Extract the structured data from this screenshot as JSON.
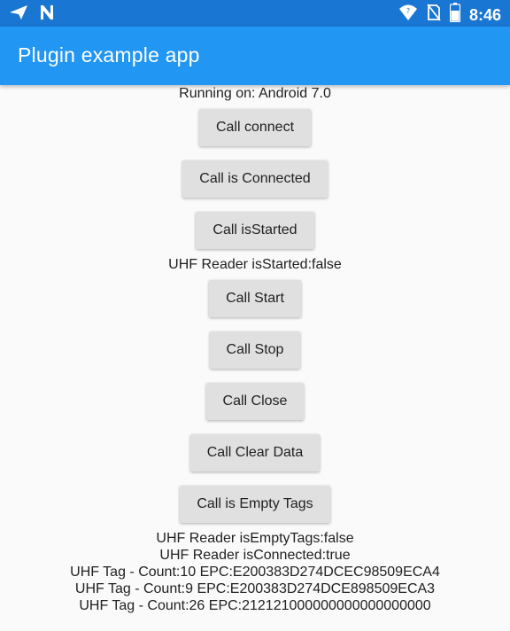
{
  "status_bar": {
    "time": "8:46",
    "icons_left": [
      "navigation-arrow-icon",
      "n-logo-icon"
    ],
    "icons_right": [
      "wifi-icon",
      "no-sim-icon",
      "battery-icon"
    ]
  },
  "app_bar": {
    "title": "Plugin example app",
    "color": "#2196f3"
  },
  "main": {
    "running_on": "Running on: Android 7.0",
    "buttons": {
      "connect": "Call connect",
      "is_connected": "Call is Connected",
      "is_started": "Call isStarted",
      "start": "Call Start",
      "stop": "Call Stop",
      "close": "Call Close",
      "clear_data": "Call Clear Data",
      "is_empty_tags": "Call is Empty Tags"
    },
    "is_started_status": "UHF Reader isStarted:false",
    "results": [
      "UHF Reader isEmptyTags:false",
      "UHF Reader isConnected:true",
      "UHF Tag - Count:10 EPC:E200383D274DCEC98509ECA4",
      "UHF Tag - Count:9 EPC:E200383D274DCE898509ECA3",
      "UHF Tag - Count:26 EPC:212121000000000000000000"
    ]
  }
}
